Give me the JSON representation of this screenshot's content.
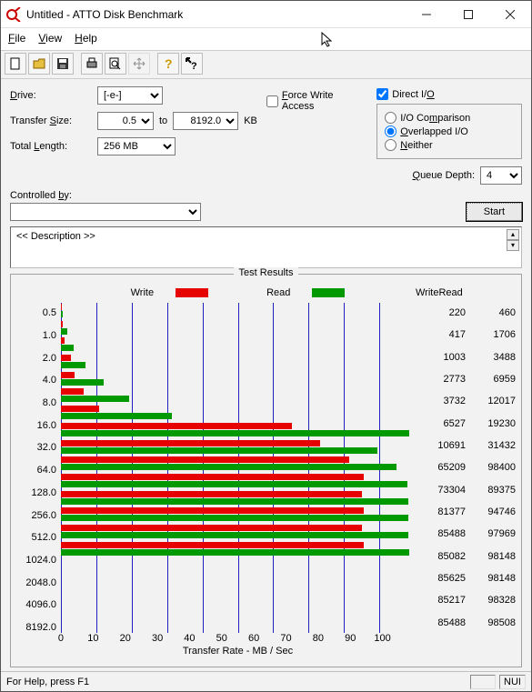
{
  "window": {
    "title": "Untitled - ATTO Disk Benchmark"
  },
  "menu": {
    "file": "File",
    "view": "View",
    "help": "Help"
  },
  "config": {
    "drive_label": "Drive:",
    "drive_value": "[-e-]",
    "transfer_label": "Transfer Size:",
    "transfer_from": "0.5",
    "transfer_to_label": "to",
    "transfer_to": "8192.0",
    "transfer_unit": "KB",
    "length_label": "Total Length:",
    "length_value": "256 MB",
    "force_write": "Force Write Access",
    "direct_io": "Direct I/O",
    "io_comparison": "I/O Comparison",
    "overlapped_io": "Overlapped I/O",
    "neither": "Neither",
    "queue_depth_label": "Queue Depth:",
    "queue_depth_value": "4",
    "controlled_by": "Controlled by:",
    "start": "Start",
    "description": "<< Description >>"
  },
  "results": {
    "title": "Test Results",
    "legend_write": "Write",
    "legend_read": "Read",
    "col_write": "Write",
    "col_read": "Read",
    "xlabel": "Transfer Rate - MB / Sec"
  },
  "status": {
    "help": "For Help, press F1",
    "indicator": "NUI"
  },
  "chart_data": {
    "type": "bar",
    "orientation": "horizontal",
    "xlabel": "Transfer Rate - MB / Sec",
    "xlim": [
      0,
      100
    ],
    "xticks": [
      0,
      10,
      20,
      30,
      40,
      50,
      60,
      70,
      80,
      90,
      100
    ],
    "categories": [
      "0.5",
      "1.0",
      "2.0",
      "4.0",
      "8.0",
      "16.0",
      "32.0",
      "64.0",
      "128.0",
      "256.0",
      "512.0",
      "1024.0",
      "2048.0",
      "4096.0",
      "8192.0"
    ],
    "series": [
      {
        "name": "Write",
        "color": "#e60000",
        "values": [
          220,
          417,
          1003,
          2773,
          3732,
          6527,
          10691,
          65209,
          73304,
          81377,
          85488,
          85082,
          85625,
          85217,
          85488
        ]
      },
      {
        "name": "Read",
        "color": "#009a00",
        "values": [
          460,
          1706,
          3488,
          6959,
          12017,
          19230,
          31432,
          98400,
          89375,
          94746,
          97969,
          98148,
          98148,
          98328,
          98508
        ]
      }
    ],
    "display_scale_divisor": 1000
  }
}
